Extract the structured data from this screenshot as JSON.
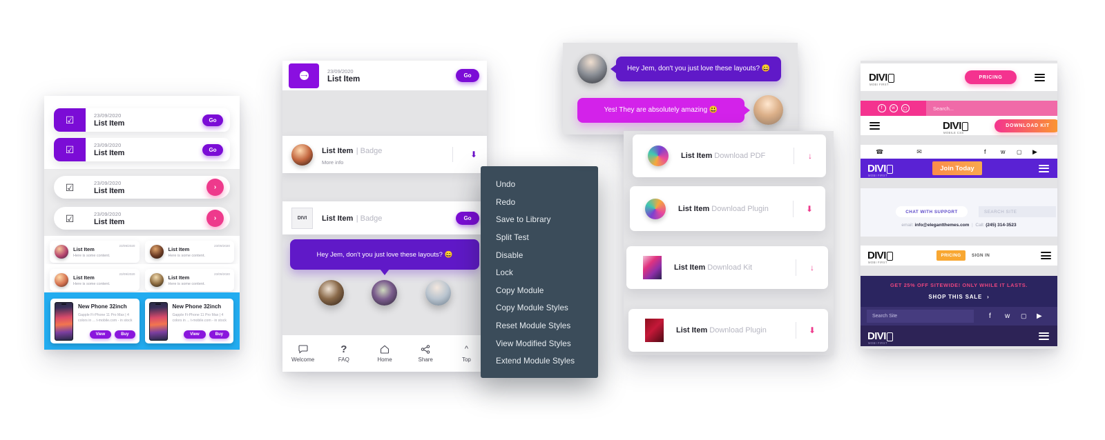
{
  "panel_list": {
    "rows_purple": [
      {
        "date": "23/09/2020",
        "title": "List Item",
        "button": "Go",
        "icon": "checkbox-icon"
      },
      {
        "date": "23/09/2020",
        "title": "List Item",
        "button": "Go",
        "icon": "checkbox-icon"
      }
    ],
    "rows_plain": [
      {
        "date": "23/09/2020",
        "title": "List Item",
        "button": "›",
        "icon": "checkbox-icon"
      },
      {
        "date": "23/09/2020",
        "title": "List Item",
        "button": "›",
        "icon": "checkbox-icon"
      }
    ],
    "mini_rows": [
      [
        {
          "title": "List Item",
          "sub": "Here is some content.",
          "date": "23/09/2020"
        },
        {
          "title": "List Item",
          "sub": "Here is some content.",
          "date": "23/09/2020"
        }
      ],
      [
        {
          "title": "List Item",
          "sub": "Here is some content.",
          "date": "23/09/2020"
        },
        {
          "title": "List Item",
          "sub": "Here is some content.",
          "date": "23/09/2020"
        }
      ]
    ],
    "products": [
      {
        "name": "New Phone 32inch",
        "desc": "Gapple Fi-Phone 11 Pro Max | 4 colors in ... t-mobile.com - in stock",
        "btn_view": "View",
        "btn_buy": "Buy"
      },
      {
        "name": "New Phone 32inch",
        "desc": "Gapple Fi-Phone 11 Pro Max | 4 colors in ... t-mobile.com - in stock",
        "btn_view": "View",
        "btn_buy": "Buy"
      }
    ]
  },
  "panel_mobile": {
    "header": {
      "date": "23/09/2020",
      "title": "List Item",
      "button": "Go",
      "icon": "arrow-circle-icon"
    },
    "cards": [
      {
        "title": "List Item",
        "badge": "| Badge",
        "sub": "More info",
        "action": "download-icon",
        "thumb": "avatar"
      },
      {
        "title": "List Item",
        "badge": "| Badge",
        "sub": "",
        "action": "Go",
        "thumb": "DIVI"
      }
    ],
    "bubble": "Hey Jem, don't you just love these layouts? 😄",
    "nav": [
      {
        "label": "Welcome",
        "icon": "chat-bubble-icon",
        "glyph": "◯"
      },
      {
        "label": "FAQ",
        "icon": "question-mark-icon",
        "glyph": "?"
      },
      {
        "label": "Home",
        "icon": "home-icon",
        "glyph": "⌂"
      },
      {
        "label": "Share",
        "icon": "share-icon",
        "glyph": "❮"
      },
      {
        "label": "Top",
        "icon": "chevron-up-icon",
        "glyph": "⌃"
      }
    ]
  },
  "context_menu": {
    "items": [
      "Undo",
      "Redo",
      "Save to Library",
      "Split Test",
      "Disable",
      "Lock",
      "Copy Module",
      "Copy Module Styles",
      "Reset Module Styles",
      "View Modified Styles",
      "Extend Module Styles"
    ]
  },
  "panel_chat": {
    "messages": [
      {
        "side": "left",
        "text": "Hey Jem, don't you just love these layouts? 😄"
      },
      {
        "side": "right",
        "text": "Yes! They are absolutely amazing 😃"
      }
    ]
  },
  "panel_downloads": {
    "items": [
      {
        "title": "List Item",
        "action": "Download PDF",
        "arrow": "↓",
        "thumb": "round-colorful"
      },
      {
        "title": "List Item",
        "action": "Download Plugin",
        "arrow": "⬇",
        "thumb": "round-colorful"
      },
      {
        "title": "List Item",
        "action": "Download Kit",
        "arrow": "↓",
        "thumb": "square-portrait"
      },
      {
        "title": "List Item",
        "action": "Download Plugin",
        "arrow": "⬇",
        "thumb": "square-red"
      }
    ]
  },
  "panel_divi": {
    "brand": "DIVI",
    "brand_sub_1": "MOBI FIRST",
    "brand_sub_2": "MOBILE CSS",
    "header_1": {
      "pricing": "PRICING",
      "menu": "hamburger-icon"
    },
    "header_2": {
      "search_placeholder": "Search...",
      "social": [
        "facebook-icon",
        "twitter-icon",
        "instagram-icon"
      ],
      "download": "DOWNLOAD KIT",
      "menu": "hamburger-icon"
    },
    "header_3": {
      "contact_icons": [
        "phone-icon",
        "mail-icon"
      ],
      "social": [
        "facebook-icon",
        "twitter-icon",
        "instagram-icon",
        "youtube-icon"
      ],
      "cta": "Join Today",
      "menu": "hamburger-icon"
    },
    "header_4": {
      "chat": "CHAT WITH SUPPORT",
      "search_placeholder": "SEARCH SITE",
      "email_label": "email:",
      "email": "info@elegantthemes.com",
      "call_label": "Call:",
      "phone": "(245) 314-3523",
      "pricing": "PRICING",
      "signin": "SIGN IN",
      "menu": "hamburger-icon"
    },
    "header_5": {
      "promo": "GET 25% OFF SITEWIDE! ONLY WHILE IT LASTS.",
      "shop": "SHOP THIS SALE",
      "shop_arrow": "›",
      "search_placeholder": "Search Site",
      "social": [
        "facebook-icon",
        "twitter-icon",
        "instagram-icon",
        "youtube-icon"
      ],
      "menu": "hamburger-icon"
    }
  },
  "colors": {
    "purple": "#7b0cd6",
    "violet": "#6019c8",
    "pink": "#ee3a8c",
    "magenta": "#d322ea",
    "blue": "#22acf0",
    "menu_bg": "#3b4c5a",
    "divi_pink": "#f4338f",
    "divi_orange": "#f7941e",
    "divi_navy": "#2b2560",
    "divi_dark": "#2d2356"
  }
}
